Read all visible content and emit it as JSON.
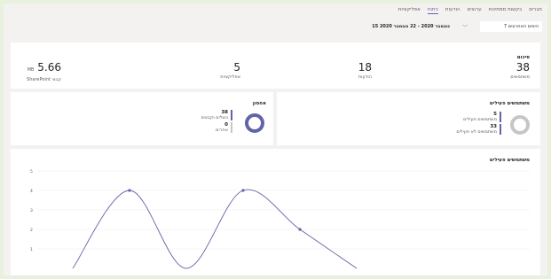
{
  "header": {
    "tabs": [
      {
        "label": "חברים",
        "active": false
      },
      {
        "label": "בקשות ממתינות",
        "active": false
      },
      {
        "label": "ערוצים",
        "active": false
      },
      {
        "label": "הודעות",
        "active": false
      },
      {
        "label": "ניתוח",
        "active": true
      },
      {
        "label": "אפליקציות",
        "active": false
      }
    ]
  },
  "filter": {
    "range_label": "7 הימים האחרונים",
    "date_range": "15 נובמבר 2020 - 22 נובמבר 2020"
  },
  "summary": {
    "title": "סיכום",
    "stats": [
      {
        "value": "38",
        "label": "משתמשים"
      },
      {
        "value": "18",
        "label": "הודעות"
      },
      {
        "value": "5",
        "label": "אפליקציות"
      },
      {
        "value": "5.66",
        "unit": "MB",
        "label": "קבצי SharePoint"
      }
    ]
  },
  "active_users": {
    "title": "משתמשים פעילים",
    "active_value": "5",
    "active_label": "משתמשים פעילים",
    "inactive_value": "33",
    "inactive_label": "משתמשים לא פעילים"
  },
  "storage": {
    "title": "אחסון",
    "used_value": "38",
    "used_label": "בשלים וקבצים",
    "other_value": "0",
    "other_label": "אחרים"
  },
  "chart_data": {
    "type": "line",
    "title": "משתמשים פעילים",
    "y_ticks": [
      "5",
      "4",
      "3",
      "2",
      "1"
    ],
    "ylim": [
      0,
      5
    ],
    "points": [
      {
        "x": 0,
        "y": 0
      },
      {
        "x": 1,
        "y": 4
      },
      {
        "x": 2,
        "y": 0
      },
      {
        "x": 3,
        "y": 4
      },
      {
        "x": 4,
        "y": 2
      },
      {
        "x": 5,
        "y": 0
      }
    ],
    "line_color": "#6264a7"
  }
}
